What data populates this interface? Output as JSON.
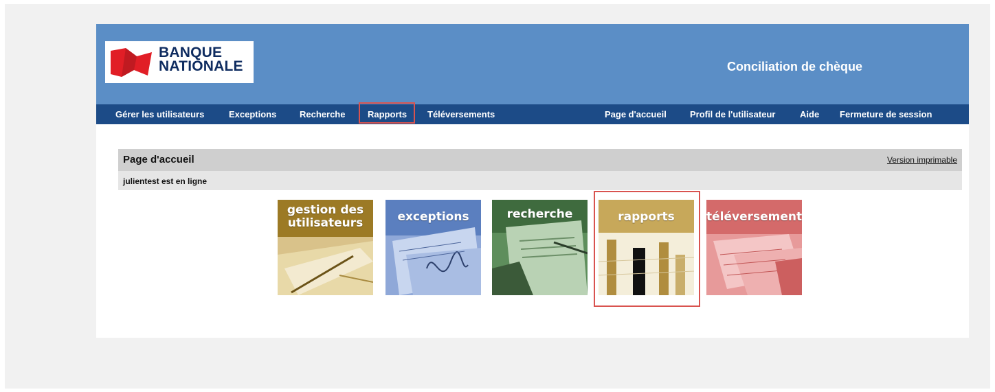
{
  "header": {
    "logo_line1": "BANQUE",
    "logo_line2": "NATIONALE",
    "app_title": "Conciliation de chèque"
  },
  "nav": {
    "left": [
      "Gérer les utilisateurs",
      "Exceptions",
      "Recherche",
      "Rapports",
      "Téléversements"
    ],
    "right": [
      "Page d'accueil",
      "Profil de l'utilisateur",
      "Aide",
      "Fermeture de session"
    ],
    "highlighted": "Rapports"
  },
  "page": {
    "title": "Page d'accueil",
    "print_link": "Version imprimable",
    "status": "julientest est en ligne"
  },
  "tiles": [
    {
      "label_line1": "gestion des",
      "label_line2": "utilisateurs",
      "color": "#b8953a",
      "icon": "pen-on-papers-image"
    },
    {
      "label_line1": "exceptions",
      "label_line2": "",
      "color": "#5b7fbf",
      "icon": "signed-cheques-image"
    },
    {
      "label_line1": "recherche",
      "label_line2": "",
      "color": "#4b7a4a",
      "icon": "magnifier-on-document-image"
    },
    {
      "label_line1": "rapports",
      "label_line2": "",
      "color": "#c7a85a",
      "icon": "bar-chart-report-image"
    },
    {
      "label_line1": "téléversements",
      "label_line2": "",
      "color": "#cf6a6a",
      "icon": "invoice-papers-image"
    }
  ],
  "colors": {
    "header_bg": "#5b8ec6",
    "navbar_bg": "#1c4b87",
    "highlight_border": "#d9534f",
    "logo_red": "#e11e26"
  }
}
